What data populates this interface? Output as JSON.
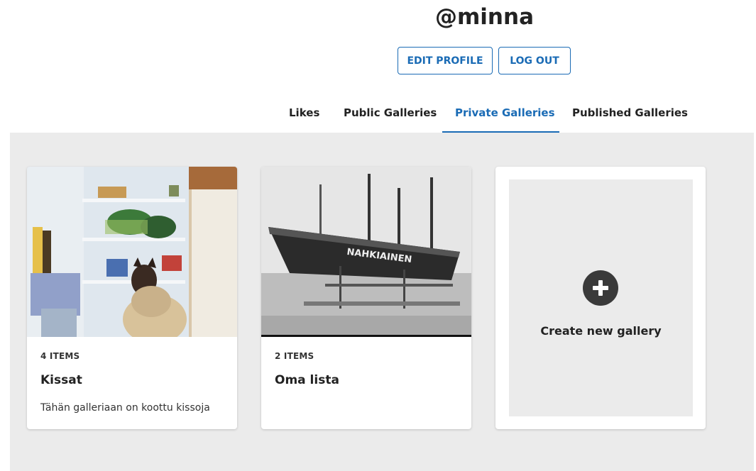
{
  "profile": {
    "username": "@minna",
    "edit_label": "EDIT PROFILE",
    "logout_label": "LOG OUT"
  },
  "tabs": [
    {
      "label": "Likes",
      "active": false
    },
    {
      "label": "Public Galleries",
      "active": false
    },
    {
      "label": "Private Galleries",
      "active": true
    },
    {
      "label": "Published Galleries",
      "active": false
    }
  ],
  "galleries": [
    {
      "count": "4 ITEMS",
      "title": "Kissat",
      "description": "Tähän galleriaan on koottu kissoja",
      "thumbnail": "cat-in-fridge-photo"
    },
    {
      "count": "2 ITEMS",
      "title": "Oma lista",
      "description": "",
      "thumbnail": "ship-nahkiainen-photo"
    }
  ],
  "create": {
    "label": "Create new gallery",
    "icon": "plus-circle-icon"
  },
  "colors": {
    "accent": "#1a6bb5",
    "panel_bg": "#ebebeb",
    "icon_dark": "#3a3a3a"
  }
}
